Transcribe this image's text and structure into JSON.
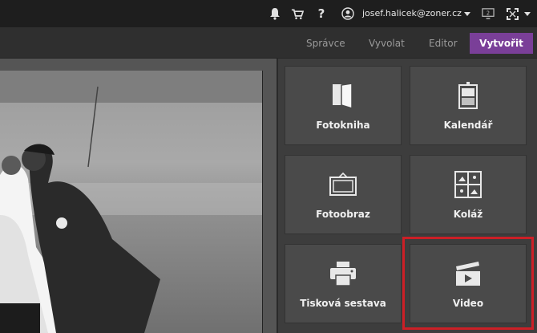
{
  "account": {
    "email": "josef.halicek@zoner.cz"
  },
  "top_icons": [
    "bell-icon",
    "cart-icon",
    "help-icon",
    "user-icon",
    "monitor-icon",
    "fullscreen-icon"
  ],
  "modules": {
    "tabs": [
      {
        "label": "Správce"
      },
      {
        "label": "Vyvolat"
      },
      {
        "label": "Editor"
      },
      {
        "label": "Vytvořit"
      }
    ],
    "active": "Vytvořit"
  },
  "create": {
    "items": [
      {
        "label": "Fotokniha",
        "icon": "photobook-icon"
      },
      {
        "label": "Kalendář",
        "icon": "calendar-icon"
      },
      {
        "label": "Fotoobraz",
        "icon": "canvas-print-icon"
      },
      {
        "label": "Koláž",
        "icon": "collage-icon"
      },
      {
        "label": "Tisková sestava",
        "icon": "printer-icon"
      },
      {
        "label": "Video",
        "icon": "video-clapper-icon"
      }
    ],
    "highlighted": "Video"
  },
  "colors": {
    "accent": "#7a3f98",
    "highlight": "#cc1f26",
    "topbar": "#1e1e1e"
  }
}
